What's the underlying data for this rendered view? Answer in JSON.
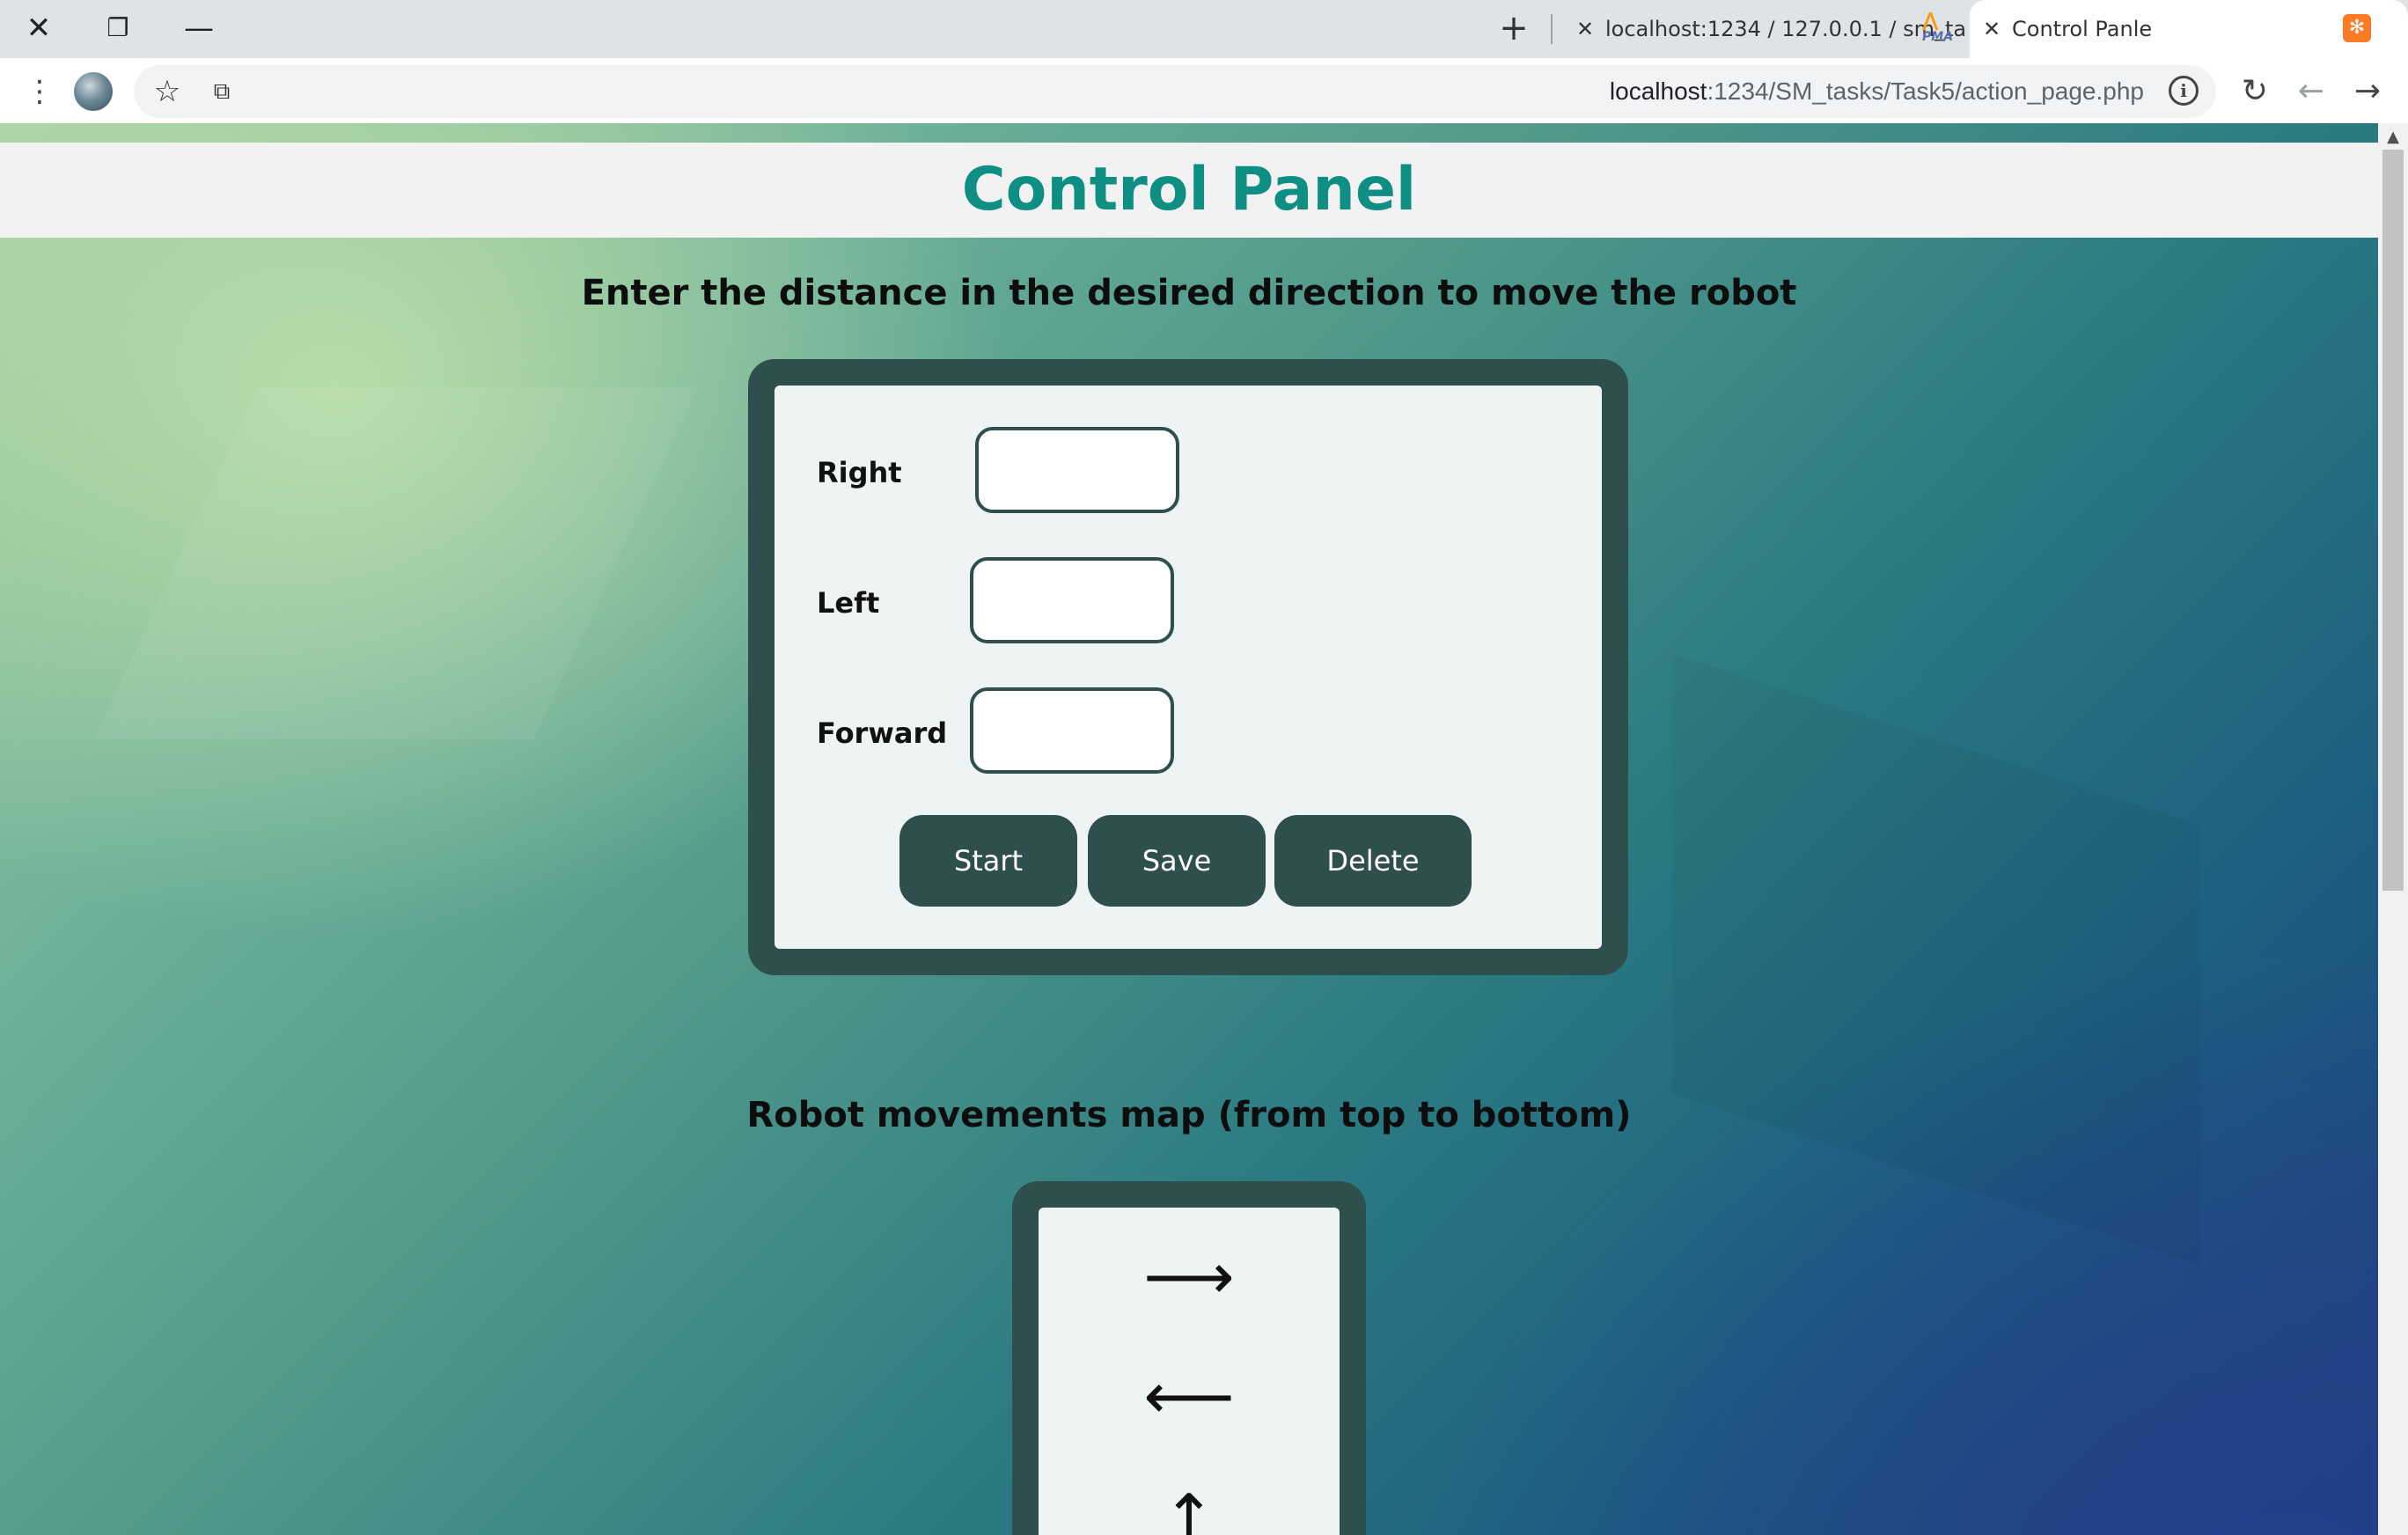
{
  "browser": {
    "tabs": [
      {
        "title": "localhost:1234 / 127.0.0.1 / sm_ta",
        "favicon": "phpmyadmin-logo",
        "favicon_text": "PMA"
      },
      {
        "title": "Control Panle",
        "favicon": "xampp-icon"
      }
    ],
    "address": {
      "host": "localhost",
      "path": ":1234/SM_tasks/Task5/action_page.php"
    }
  },
  "page": {
    "title": "Control Panel",
    "instruction": "Enter the distance in the desired direction to move the robot",
    "form": {
      "fields": [
        {
          "label": "Right",
          "value": ""
        },
        {
          "label": "Left",
          "value": ""
        },
        {
          "label": "Forward",
          "value": ""
        }
      ],
      "buttons": {
        "start": "Start",
        "save": "Save",
        "delete": "Delete"
      }
    },
    "map": {
      "heading": "Robot movements map (from top to bottom)",
      "moves": [
        "⟶",
        "⟵",
        "↑"
      ]
    }
  },
  "colors": {
    "accent": "#0f8f84",
    "panel": "#2f4f4f",
    "panel_inner": "#eef4f4"
  }
}
